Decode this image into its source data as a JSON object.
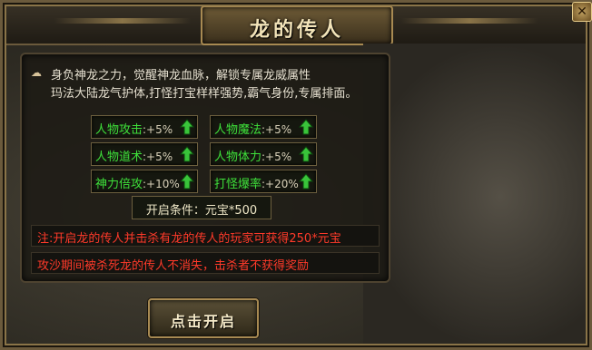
{
  "window": {
    "title": "龙的传人",
    "close_glyph": "✕"
  },
  "description": {
    "line1": "身负神龙之力，觉醒神龙血脉，解锁专属龙威属性",
    "line2": "玛法大陆龙气护体,打怪打宝样样强势,霸气身份,专属排面。"
  },
  "attributes": [
    {
      "label": "人物攻击",
      "value": ":+5%",
      "icon": "arrow-up-icon"
    },
    {
      "label": "人物魔法",
      "value": ":+5%",
      "icon": "arrow-up-icon"
    },
    {
      "label": "人物道术",
      "value": ":+5%",
      "icon": "arrow-up-icon"
    },
    {
      "label": "人物体力",
      "value": ":+5%",
      "icon": "arrow-up-icon"
    },
    {
      "label": "神力倍攻",
      "value": ":+10%",
      "icon": "arrow-up-icon"
    },
    {
      "label": "打怪爆率",
      "value": ":+20%",
      "icon": "arrow-up-icon"
    }
  ],
  "condition": "开启条件：元宝*500",
  "notes": {
    "note1": "注:开启龙的传人并击杀有龙的传人的玩家可获得250*元宝",
    "note2": "攻沙期间被杀死龙的传人不消失，击杀者不获得奖励"
  },
  "buttons": {
    "open": "点击开启"
  },
  "colors": {
    "attr_label": "#3ee03a",
    "note_red": "#ff3a2a",
    "gold_border": "#a88a52"
  }
}
